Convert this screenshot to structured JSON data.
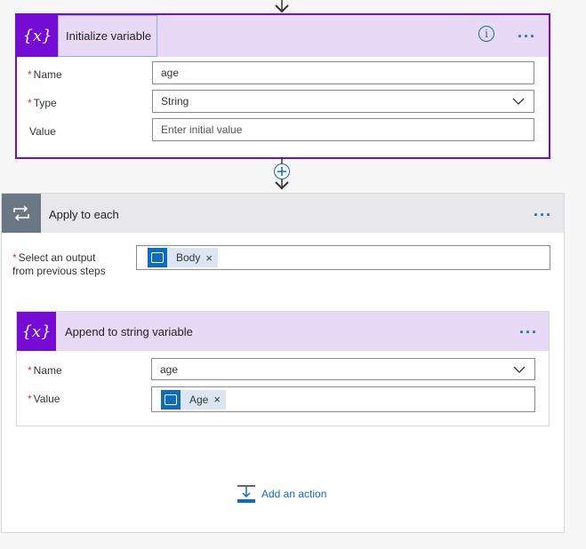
{
  "init_variable": {
    "title": "Initialize variable",
    "name_label": "Name",
    "name_value": "age",
    "type_label": "Type",
    "type_value": "String",
    "value_label": "Value",
    "value_placeholder": "Enter initial value",
    "required_mark": "*",
    "icon_text": "{x}",
    "info_icon": "i"
  },
  "apply_to_each": {
    "title": "Apply to each",
    "select_label_line1": "Select an output",
    "select_label_line2": "from previous steps",
    "token_label": "Body",
    "token_remove": "×",
    "required_mark": "*"
  },
  "append_variable": {
    "title": "Append to string variable",
    "name_label": "Name",
    "name_value": "age",
    "value_label": "Value",
    "token_label": "Age",
    "token_remove": "×",
    "required_mark": "*",
    "icon_text": "{x}"
  },
  "add_action": {
    "label": "Add an action"
  },
  "more_options": "···",
  "colors": {
    "variable_accent": "#770bd6",
    "variable_header": "#e8d9f7",
    "loop_accent": "#6b7785",
    "loop_header": "#e8e8ea",
    "link_blue": "#0f6cbd"
  }
}
